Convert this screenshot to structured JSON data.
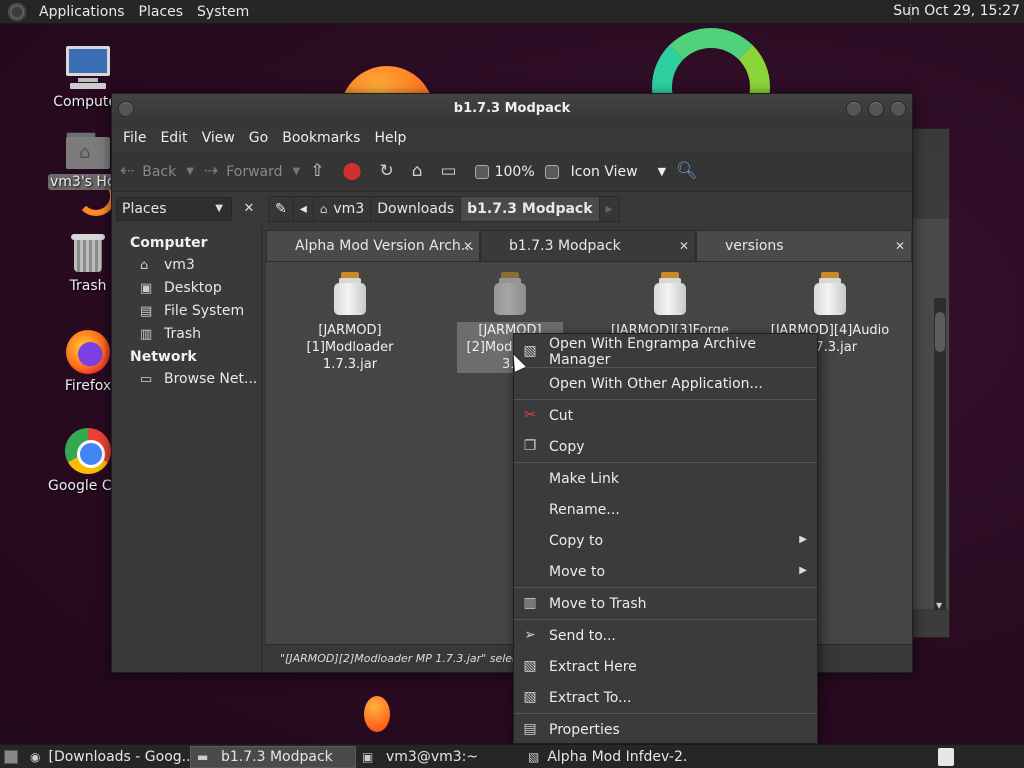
{
  "top_panel": {
    "menus": [
      "Applications",
      "Places",
      "System"
    ],
    "clock": "Sun Oct 29, 15:27"
  },
  "desktop_icons": [
    {
      "label": "Computer",
      "icon": "computer-icon"
    },
    {
      "label": "vm3's Home",
      "icon": "home-folder-icon"
    },
    {
      "label": "Trash",
      "icon": "trash-icon"
    },
    {
      "label": "Firefox",
      "icon": "firefox-icon"
    },
    {
      "label": "Google Chrome",
      "icon": "chrome-icon"
    }
  ],
  "window": {
    "title": "b1.7.3 Modpack",
    "menubar": [
      "File",
      "Edit",
      "View",
      "Go",
      "Bookmarks",
      "Help"
    ],
    "toolbar": {
      "back": "Back",
      "forward": "Forward",
      "zoom": "100%",
      "view_mode": "Icon View"
    },
    "places_label": "Places",
    "breadcrumbs": [
      "vm3",
      "Downloads",
      "b1.7.3 Modpack"
    ],
    "sidebar": {
      "computer_heading": "Computer",
      "computer_items": [
        "vm3",
        "Desktop",
        "File System",
        "Trash"
      ],
      "network_heading": "Network",
      "network_items": [
        "Browse Net..."
      ]
    },
    "tabs": [
      "Alpha Mod Version Arch...",
      "b1.7.3 Modpack",
      "versions"
    ],
    "files": [
      {
        "line1": "[JARMOD]",
        "line2": "[1]Modloader 1.7.3.jar"
      },
      {
        "line1": "[JARMOD]",
        "line2": "[2]Modloader",
        "line3": "3.j"
      },
      {
        "line1": "[JARMOD][3]Forge 1",
        "line2": ""
      },
      {
        "line1": "[JARMOD][4]Audio",
        "line2": "1.7.3.jar"
      }
    ],
    "status": "\"[JARMOD][2]Modloader MP 1.7.3.jar\" selected"
  },
  "context_menu": [
    {
      "label": "Open With Engrampa Archive Manager",
      "icon": "archive-icon"
    },
    {
      "label": "Open With Other Application...",
      "icon": ""
    },
    {
      "label": "Cut",
      "icon": "scissors-icon"
    },
    {
      "label": "Copy",
      "icon": "copy-icon"
    },
    {
      "label": "Make Link",
      "icon": ""
    },
    {
      "label": "Rename...",
      "icon": ""
    },
    {
      "label": "Copy to",
      "icon": ""
    },
    {
      "label": "Move to",
      "icon": ""
    },
    {
      "label": "Move to Trash",
      "icon": "trash-icon"
    },
    {
      "label": "Send to...",
      "icon": "send-icon"
    },
    {
      "label": "Extract Here",
      "icon": "extract-icon"
    },
    {
      "label": "Extract To...",
      "icon": "extract-icon"
    },
    {
      "label": "Properties",
      "icon": "properties-icon"
    }
  ],
  "taskbar": [
    {
      "label": "[Downloads - Goog...",
      "icon": "chrome-icon",
      "active": false
    },
    {
      "label": "b1.7.3 Modpack",
      "icon": "folder-icon",
      "active": true
    },
    {
      "label": "vm3@vm3:~",
      "icon": "terminal-icon",
      "active": false
    },
    {
      "label": "Alpha Mod Infdev-2...",
      "icon": "archive-icon",
      "active": false
    }
  ]
}
